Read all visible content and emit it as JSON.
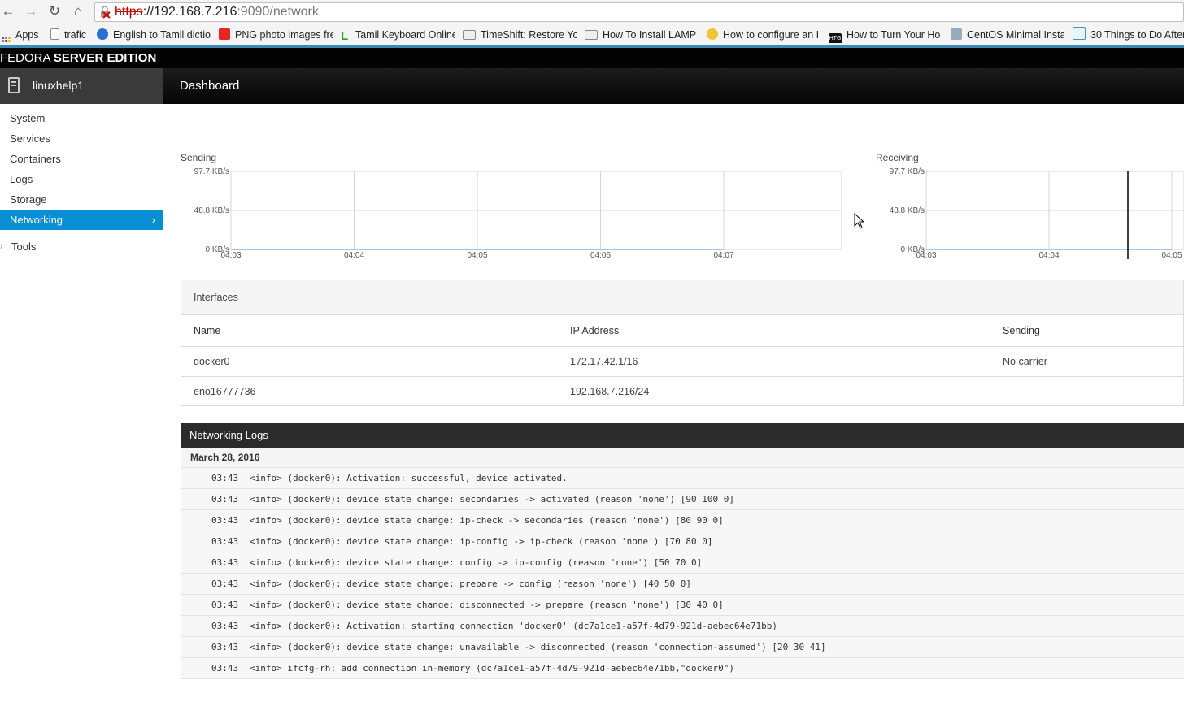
{
  "browser": {
    "url_scheme": "https",
    "url_host": "://192.168.7.216",
    "url_rest": ":9090/network",
    "bookmarks": [
      {
        "label": "Apps",
        "icon": "apps-grid-icon"
      },
      {
        "label": "trafic",
        "icon": "page-icon"
      },
      {
        "label": "English to Tamil dictio",
        "icon": "globe-icon"
      },
      {
        "label": "PNG photo images fre",
        "icon": "red-bookmark-icon"
      },
      {
        "label": "Tamil Keyboard Online",
        "icon": "green-l-icon"
      },
      {
        "label": "TimeShift: Restore Yo",
        "icon": "page-icon"
      },
      {
        "label": "How To Install LAMP",
        "icon": "page-icon"
      },
      {
        "label": "How to configure an I",
        "icon": "bulb-icon"
      },
      {
        "label": "How to Turn Your Ho",
        "icon": "htg-icon"
      },
      {
        "label": "CentOS Minimal Insta",
        "icon": "tools-icon"
      },
      {
        "label": "30 Things to Do After",
        "icon": "link-icon"
      }
    ]
  },
  "brand": {
    "light": "FEDORA ",
    "bold": "SERVER EDITION"
  },
  "host": {
    "name": "linuxhelp1"
  },
  "page": {
    "title": "Dashboard"
  },
  "sidebar": {
    "items": [
      {
        "label": "System"
      },
      {
        "label": "Services"
      },
      {
        "label": "Containers"
      },
      {
        "label": "Logs"
      },
      {
        "label": "Storage"
      },
      {
        "label": "Networking",
        "active": true,
        "chevron": "›"
      }
    ],
    "tools": {
      "caret": "›",
      "label": "Tools"
    }
  },
  "colors": {
    "accent": "#0a8fd6",
    "brand_bar": "#030303",
    "header_dark": "#2b2b2b"
  },
  "chart_data": [
    {
      "type": "line",
      "title": "Sending",
      "x": [
        "04:03",
        "04:04",
        "04:05",
        "04:06",
        "04:07"
      ],
      "yticks": [
        "97.7 KB/s",
        "48.8 KB/s",
        "0 KB/s"
      ],
      "ylim": [
        0,
        97.7
      ],
      "series": [
        {
          "values": [
            0,
            0,
            0,
            0,
            0
          ]
        }
      ],
      "grid": true
    },
    {
      "type": "line",
      "title": "Receiving",
      "x": [
        "04:03",
        "04:04",
        "04:05"
      ],
      "yticks": [
        "97.7 KB/s",
        "48.8 KB/s",
        "0 KB/s"
      ],
      "ylim": [
        0,
        97.7
      ],
      "series": [
        {
          "values": [
            0,
            0,
            0
          ]
        }
      ],
      "grid": true
    }
  ],
  "interfaces": {
    "title": "Interfaces",
    "columns": [
      "Name",
      "IP Address",
      "Sending"
    ],
    "rows": [
      {
        "name": "docker0",
        "ip": "172.17.42.1/16",
        "sending": "No carrier"
      },
      {
        "name": "eno16777736",
        "ip": "192.168.7.216/24",
        "sending": ""
      }
    ]
  },
  "logs": {
    "title": "Networking Logs",
    "date": "March 28, 2016",
    "entries": [
      {
        "time": "03:43",
        "message": "<info> (docker0): Activation: successful, device activated."
      },
      {
        "time": "03:43",
        "message": "<info> (docker0): device state change: secondaries -> activated (reason 'none') [90 100 0]"
      },
      {
        "time": "03:43",
        "message": "<info> (docker0): device state change: ip-check -> secondaries (reason 'none') [80 90 0]"
      },
      {
        "time": "03:43",
        "message": "<info> (docker0): device state change: ip-config -> ip-check (reason 'none') [70 80 0]"
      },
      {
        "time": "03:43",
        "message": "<info> (docker0): device state change: config -> ip-config (reason 'none') [50 70 0]"
      },
      {
        "time": "03:43",
        "message": "<info> (docker0): device state change: prepare -> config (reason 'none') [40 50 0]"
      },
      {
        "time": "03:43",
        "message": "<info> (docker0): device state change: disconnected -> prepare (reason 'none') [30 40 0]"
      },
      {
        "time": "03:43",
        "message": "<info> (docker0): Activation: starting connection 'docker0' (dc7a1ce1-a57f-4d79-921d-aebec64e71bb)"
      },
      {
        "time": "03:43",
        "message": "<info> (docker0): device state change: unavailable -> disconnected (reason 'connection-assumed') [20 30 41]"
      },
      {
        "time": "03:43",
        "message": "<info> ifcfg-rh: add connection in-memory (dc7a1ce1-a57f-4d79-921d-aebec64e71bb,\"docker0\")"
      }
    ]
  }
}
